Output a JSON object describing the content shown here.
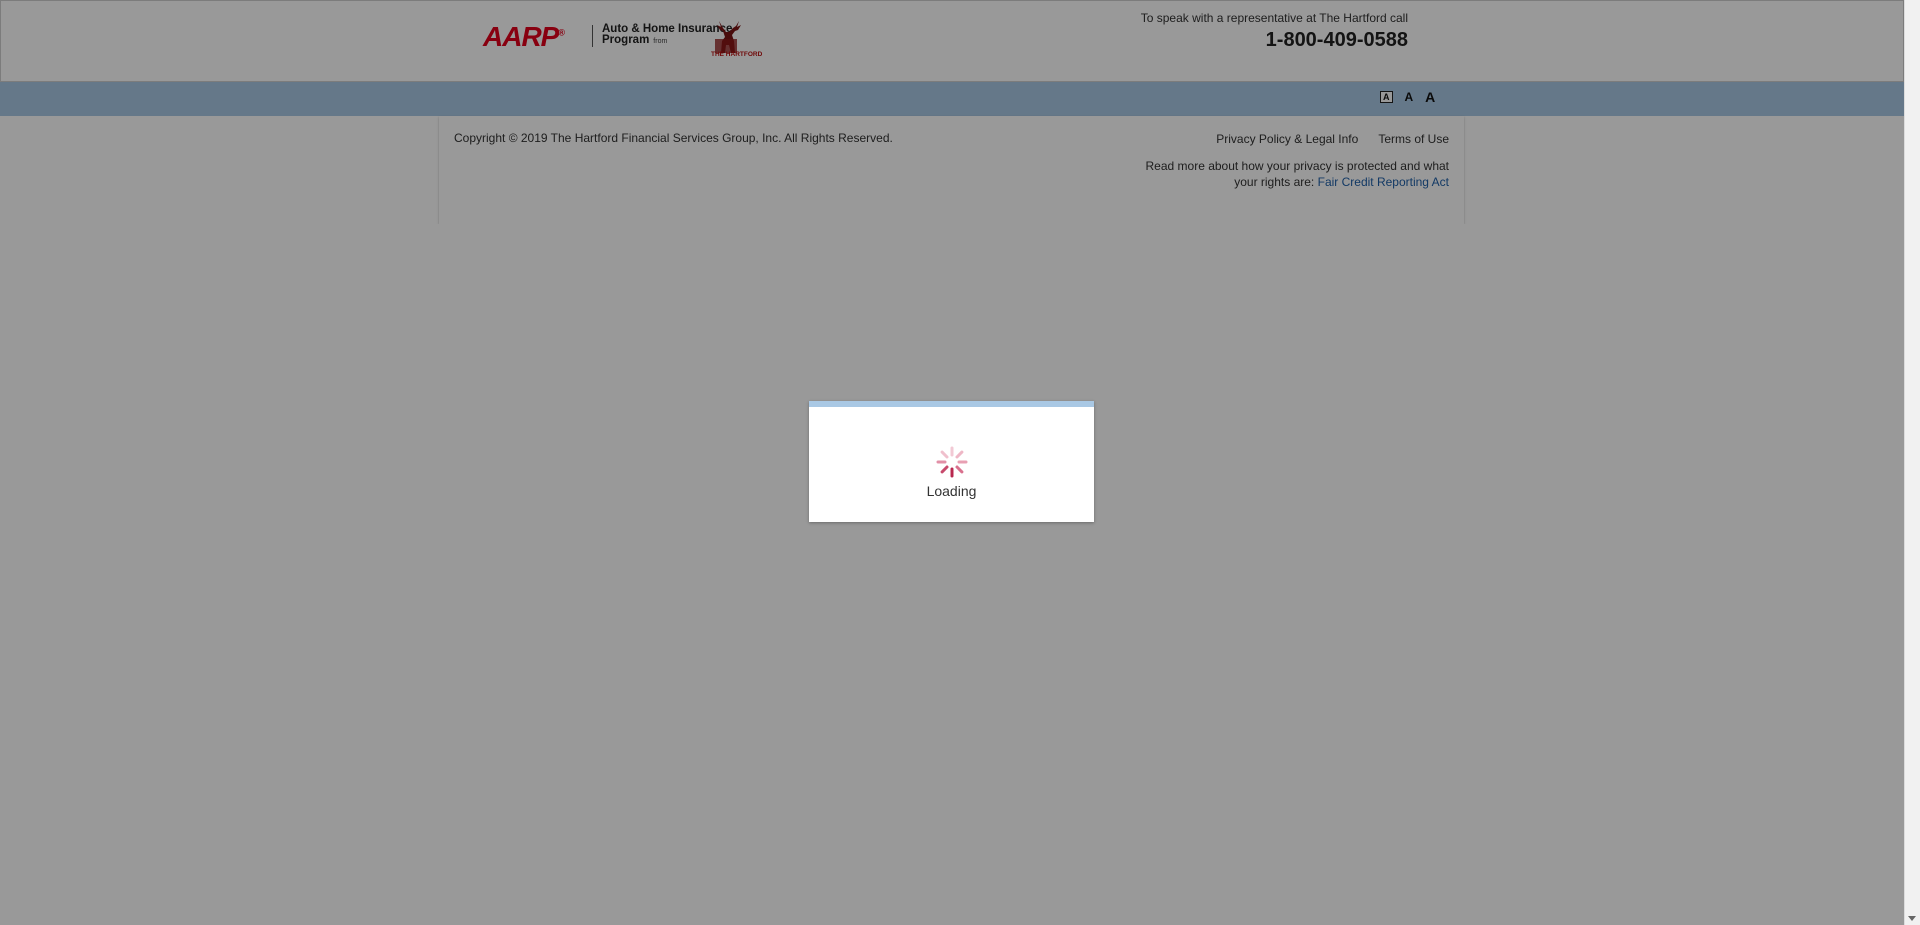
{
  "header": {
    "logo": {
      "brand": "AARP",
      "registered": "®",
      "line1": "Auto & Home Insurance",
      "line2": "Program",
      "from": "from",
      "partner": "THE HARTFORD"
    },
    "contact_label": "To speak with a representative at The Hartford call",
    "phone": "1-800-409-0588"
  },
  "toolbar": {
    "font_small": "A",
    "font_medium": "A",
    "font_large": "A"
  },
  "footer": {
    "copyright": "Copyright © 2019 The Hartford Financial Services Group, Inc. All Rights Reserved.",
    "links": [
      "Privacy Policy & Legal Info",
      "Terms of Use"
    ],
    "privacy_note": "Read more about how your privacy is protected and what your rights are:",
    "fcra_link": "Fair Credit Reporting Act"
  },
  "loading_dialog": {
    "text": "Loading"
  },
  "colors": {
    "brand_red": "#e3001b",
    "toolbar_blue": "#a9c8e4",
    "link_blue": "#1f5fa8"
  }
}
